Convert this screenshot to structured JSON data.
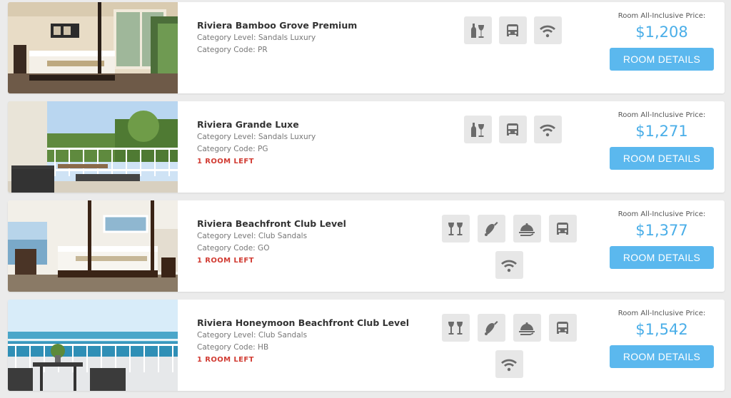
{
  "colors": {
    "accent": "#4aaee8",
    "button": "#5bb8ee",
    "alert": "#d13b32",
    "icon": "#6b6b6b",
    "icon_bg": "#e7e7e7"
  },
  "rooms": [
    {
      "name": "Riviera Bamboo Grove Premium",
      "category_level": "Category Level: Sandals Luxury",
      "category_code": "Category Code: PR",
      "rooms_left": "",
      "price_label": "Room All-Inclusive Price:",
      "price": "$1,208",
      "button_label": "ROOM DETAILS",
      "amenities": [
        "wine-icon",
        "car-icon",
        "wifi-icon"
      ]
    },
    {
      "name": "Riviera Grande Luxe",
      "category_level": "Category Level: Sandals Luxury",
      "category_code": "Category Code: PG",
      "rooms_left": "1 ROOM LEFT",
      "price_label": "Room All-Inclusive Price:",
      "price": "$1,271",
      "button_label": "ROOM DETAILS",
      "amenities": [
        "wine-icon",
        "car-icon",
        "wifi-icon"
      ]
    },
    {
      "name": "Riviera Beachfront Club Level",
      "category_level": "Category Level: Club Sandals",
      "category_code": "Category Code: GO",
      "rooms_left": "1 ROOM LEFT",
      "price_label": "Room All-Inclusive Price:",
      "price": "$1,377",
      "button_label": "ROOM DETAILS",
      "amenities": [
        "wine-glasses-icon",
        "bell-icon",
        "room-service-icon",
        "car-icon",
        "wifi-icon"
      ]
    },
    {
      "name": "Riviera Honeymoon Beachfront Club Level",
      "category_level": "Category Level: Club Sandals",
      "category_code": "Category Code: HB",
      "rooms_left": "1 ROOM LEFT",
      "price_label": "Room All-Inclusive Price:",
      "price": "$1,542",
      "button_label": "ROOM DETAILS",
      "amenities": [
        "wine-glasses-icon",
        "bell-icon",
        "room-service-icon",
        "car-icon",
        "wifi-icon"
      ]
    }
  ]
}
